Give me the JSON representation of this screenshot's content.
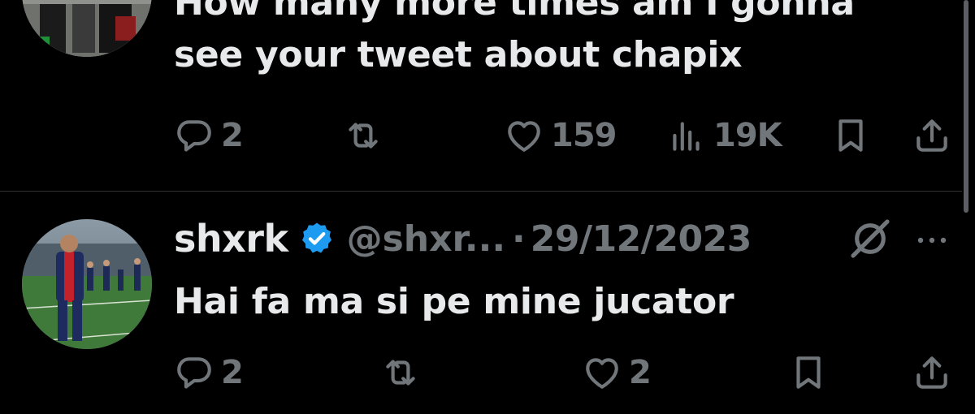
{
  "tweets": [
    {
      "text_lines": [
        "How many more times am I gonna",
        "see your tweet about chapix"
      ],
      "actions": {
        "replies": "2",
        "reposts": "",
        "likes": "159",
        "views": "19K"
      }
    },
    {
      "display_name": "shxrk",
      "handle": "@shxr...",
      "separator": "·",
      "date": "29/12/2023",
      "text": "Hai fa ma si pe mine jucator",
      "actions": {
        "replies": "2",
        "reposts": "",
        "likes": "2"
      }
    }
  ],
  "colors": {
    "background": "#000000",
    "text_primary": "#e7e9ea",
    "text_secondary": "#71767b",
    "verified_badge": "#1d9bf0",
    "divider": "#2f3336"
  },
  "icons": [
    "reply-icon",
    "repost-icon",
    "like-icon",
    "views-icon",
    "bookmark-icon",
    "share-icon",
    "verified-badge-icon",
    "grok-icon",
    "more-icon"
  ]
}
